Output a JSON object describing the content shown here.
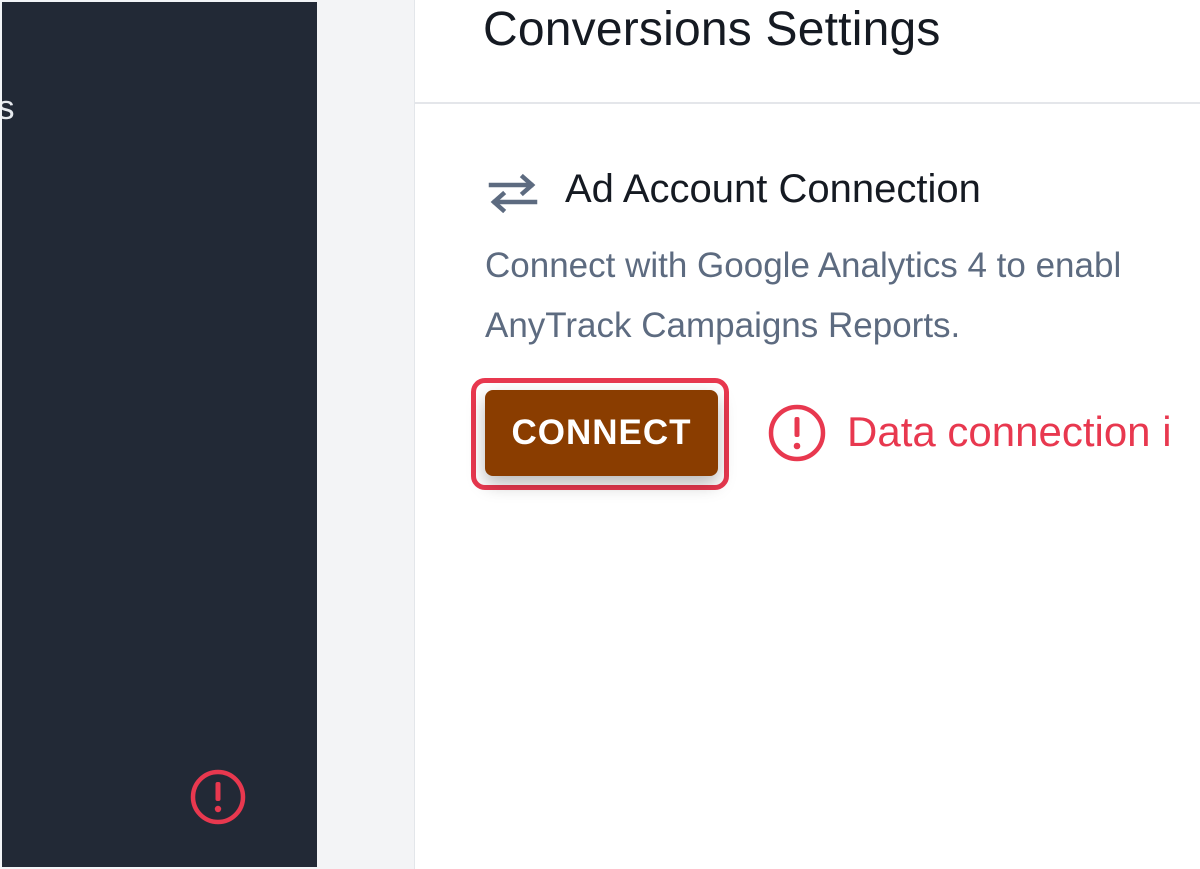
{
  "sidebar": {
    "items": [
      {
        "label": "ts"
      },
      {
        "label": "s"
      }
    ]
  },
  "header": {
    "title": "Conversions Settings"
  },
  "section": {
    "icon": "swap-arrows-icon",
    "title": "Ad Account Connection",
    "description_lines": [
      "Connect with Google Analytics 4 to enabl",
      "AnyTrack Campaigns Reports."
    ]
  },
  "actions": {
    "connect_label": "CONNECT"
  },
  "status": {
    "icon": "alert-circle-icon",
    "message": "Data connection i"
  },
  "colors": {
    "sidebar_bg": "#222936",
    "button_bg": "#8a3d00",
    "highlight": "#e8384f",
    "error": "#e8384f",
    "muted_text": "#5d6b80"
  }
}
